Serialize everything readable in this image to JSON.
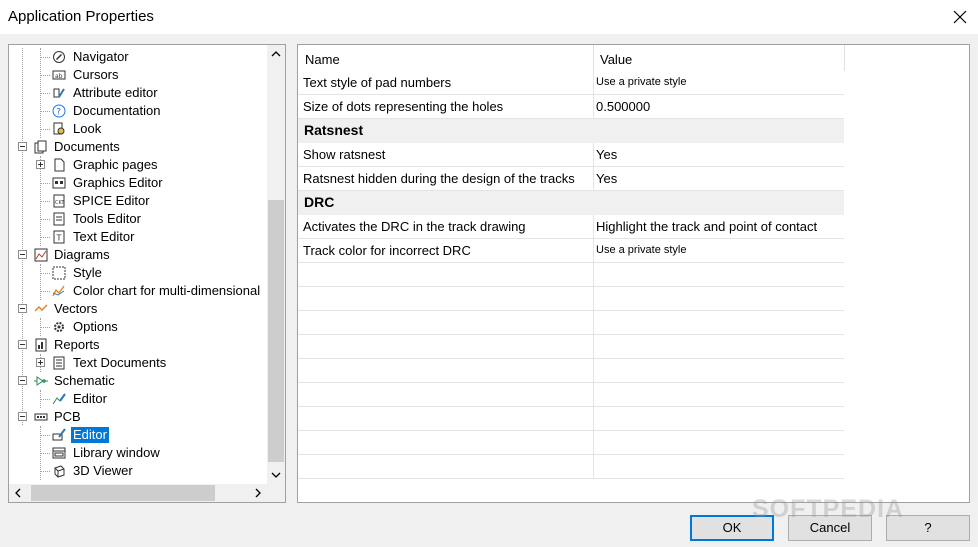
{
  "window": {
    "title": "Application Properties"
  },
  "tree": {
    "items": [
      {
        "label": "Navigator",
        "icon": "compass-icon"
      },
      {
        "label": "Cursors",
        "icon": "cursors-icon"
      },
      {
        "label": "Attribute editor",
        "icon": "attribute-editor-icon"
      },
      {
        "label": "Documentation",
        "icon": "help-icon"
      },
      {
        "label": "Look",
        "icon": "look-icon"
      },
      {
        "label": "Documents",
        "icon": "documents-icon"
      },
      {
        "label": "Graphic pages",
        "icon": "page-icon"
      },
      {
        "label": "Graphics Editor",
        "icon": "graphics-editor-icon"
      },
      {
        "label": "SPICE Editor",
        "icon": "spice-editor-icon"
      },
      {
        "label": "Tools Editor",
        "icon": "tools-editor-icon"
      },
      {
        "label": "Text Editor",
        "icon": "text-editor-icon"
      },
      {
        "label": "Diagrams",
        "icon": "diagram-icon"
      },
      {
        "label": "Style",
        "icon": "style-icon"
      },
      {
        "label": "Color chart for multi-dimensional",
        "icon": "color-chart-icon"
      },
      {
        "label": "Vectors",
        "icon": "vectors-icon"
      },
      {
        "label": "Options",
        "icon": "options-icon"
      },
      {
        "label": "Reports",
        "icon": "reports-icon"
      },
      {
        "label": "Text Documents",
        "icon": "text-documents-icon"
      },
      {
        "label": "Schematic",
        "icon": "schematic-icon"
      },
      {
        "label": "Editor",
        "icon": "schematic-editor-icon"
      },
      {
        "label": "PCB",
        "icon": "pcb-icon"
      },
      {
        "label": "Editor",
        "icon": "pcb-editor-icon"
      },
      {
        "label": "Library window",
        "icon": "library-window-icon"
      },
      {
        "label": "3D Viewer",
        "icon": "3d-viewer-icon"
      }
    ],
    "selected_index": 21
  },
  "grid": {
    "headers": {
      "name": "Name",
      "value": "Value"
    },
    "rows": [
      {
        "type": "prop",
        "name": "Text style of pad numbers",
        "value": "Use a private style"
      },
      {
        "type": "prop",
        "name": "Size of dots representing the holes",
        "value": "0.500000"
      },
      {
        "type": "group",
        "name": "Ratsnest"
      },
      {
        "type": "prop",
        "name": "Show ratsnest",
        "value": "Yes"
      },
      {
        "type": "prop",
        "name": "Ratsnest hidden during the design of the tracks",
        "value": "Yes"
      },
      {
        "type": "group",
        "name": "DRC"
      },
      {
        "type": "prop",
        "name": "Activates the DRC in the track drawing",
        "value": "Highlight the track and point of contact"
      },
      {
        "type": "prop",
        "name": "Track color for incorrect DRC",
        "value": "Use a private style"
      }
    ]
  },
  "buttons": {
    "ok": "OK",
    "cancel": "Cancel",
    "help": "?"
  },
  "watermark": "SOFTPEDIA",
  "colors": {
    "selection": "#0078d7",
    "default_button_border": "#0078d7"
  }
}
